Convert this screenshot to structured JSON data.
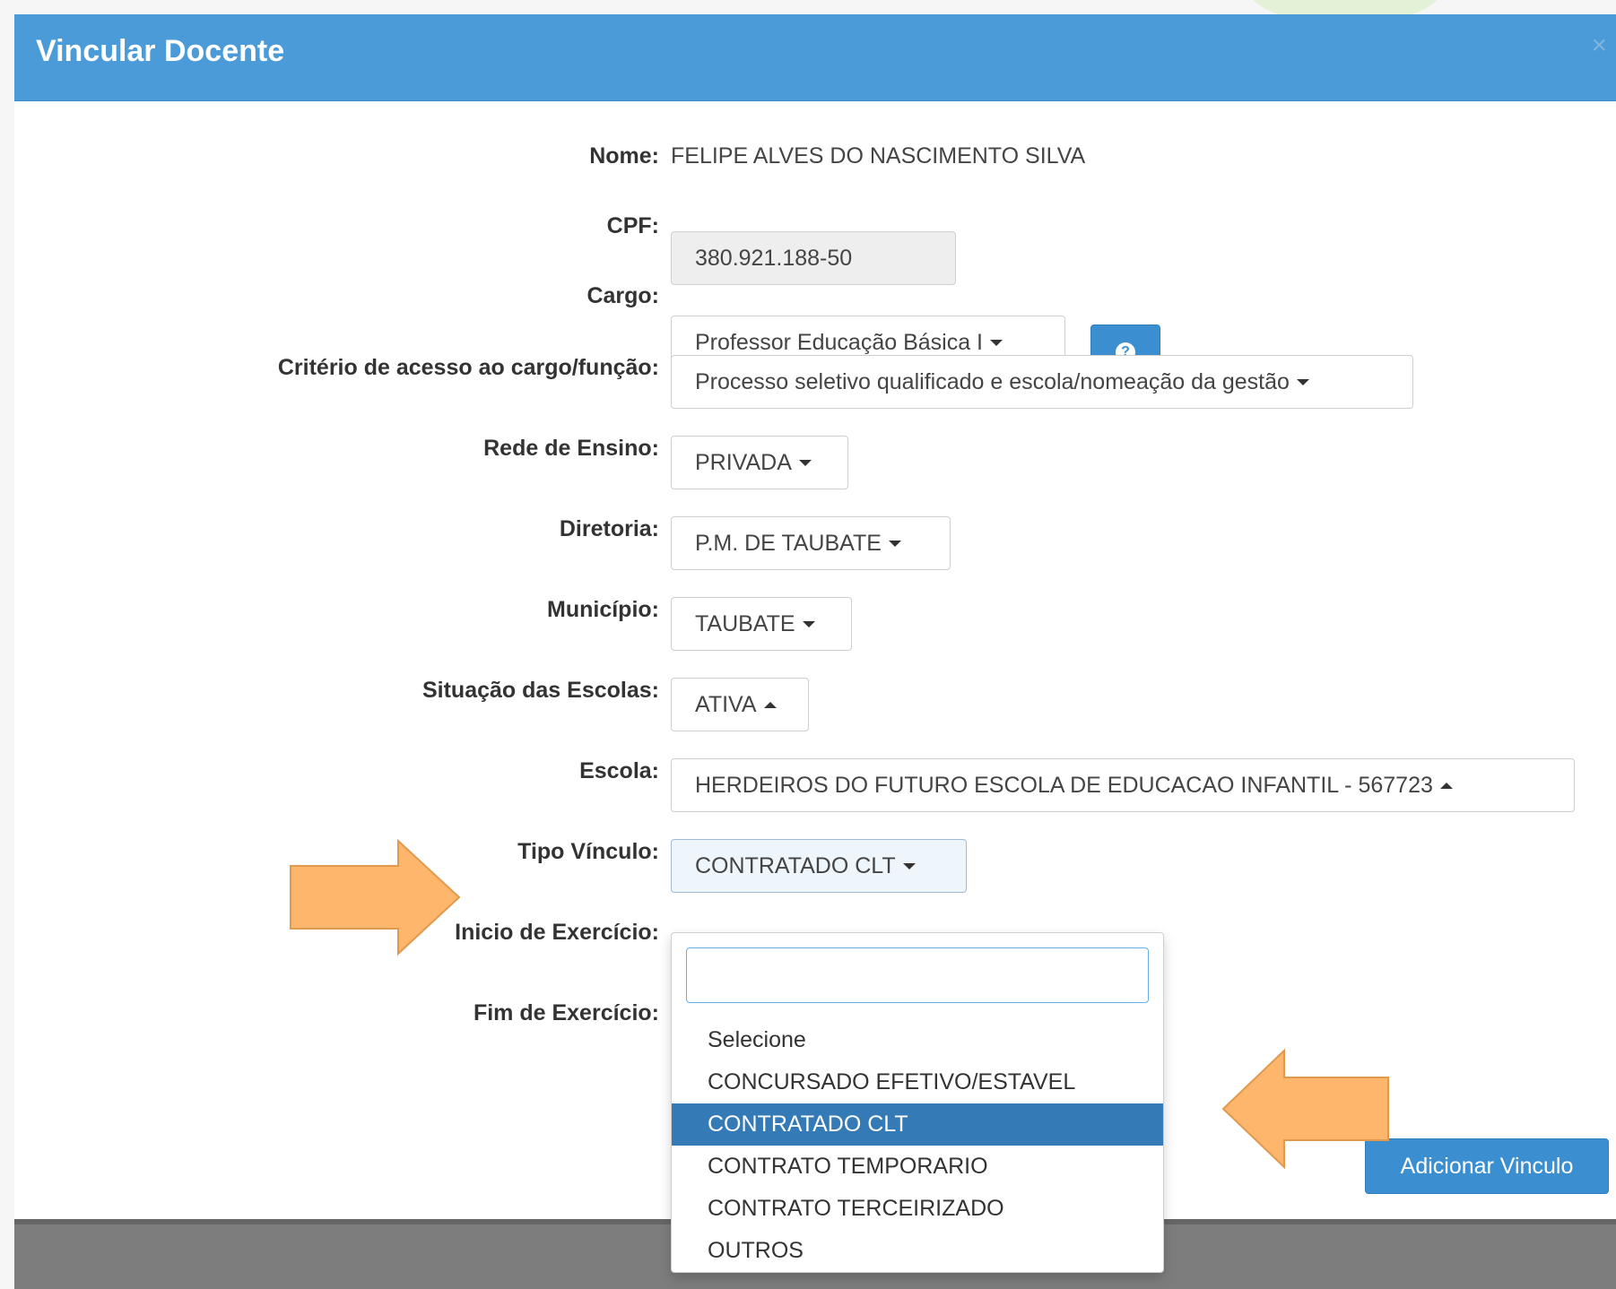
{
  "modal": {
    "title": "Vincular Docente",
    "close_label": "×"
  },
  "form": {
    "nome_label": "Nome:",
    "nome_value": "FELIPE ALVES DO NASCIMENTO SILVA",
    "cpf_label": "CPF:",
    "cpf_value": "380.921.188-50",
    "cargo_label": "Cargo:",
    "cargo_value": "Professor Educação Básica I",
    "criterio_label": "Critério de acesso ao cargo/função:",
    "criterio_value": "Processo seletivo qualificado e escola/nomeação da gestão",
    "rede_label": "Rede de Ensino:",
    "rede_value": "PRIVADA",
    "diretoria_label": "Diretoria:",
    "diretoria_value": "P.M. DE TAUBATE",
    "municipio_label": "Município:",
    "municipio_value": "TAUBATE",
    "situacao_label": "Situação das Escolas:",
    "situacao_value": "ATIVA",
    "escola_label": "Escola:",
    "escola_value": "HERDEIROS DO FUTURO ESCOLA DE EDUCACAO INFANTIL - 567723",
    "tipo_label": "Tipo Vínculo:",
    "tipo_value": "CONTRATADO CLT",
    "inicio_label": "Inicio de Exercício:",
    "fim_label": "Fim de Exercício:"
  },
  "dropdown": {
    "search_value": "",
    "options": [
      "Selecione",
      "CONCURSADO EFETIVO/ESTAVEL",
      "CONTRATADO CLT",
      "CONTRATO TEMPORARIO",
      "CONTRATO TERCEIRIZADO",
      "OUTROS"
    ],
    "selected": "CONTRATADO CLT"
  },
  "actions": {
    "add_label": "Adicionar Vinculo"
  },
  "colors": {
    "header_bg": "#4a9bd7",
    "button_bg": "#3b8fd0",
    "selected_bg": "#337ab7",
    "arrow": "#fdb66b"
  },
  "icons": {
    "help": "question-circle-icon",
    "close": "close-icon",
    "annotation": "arrow-icon"
  }
}
